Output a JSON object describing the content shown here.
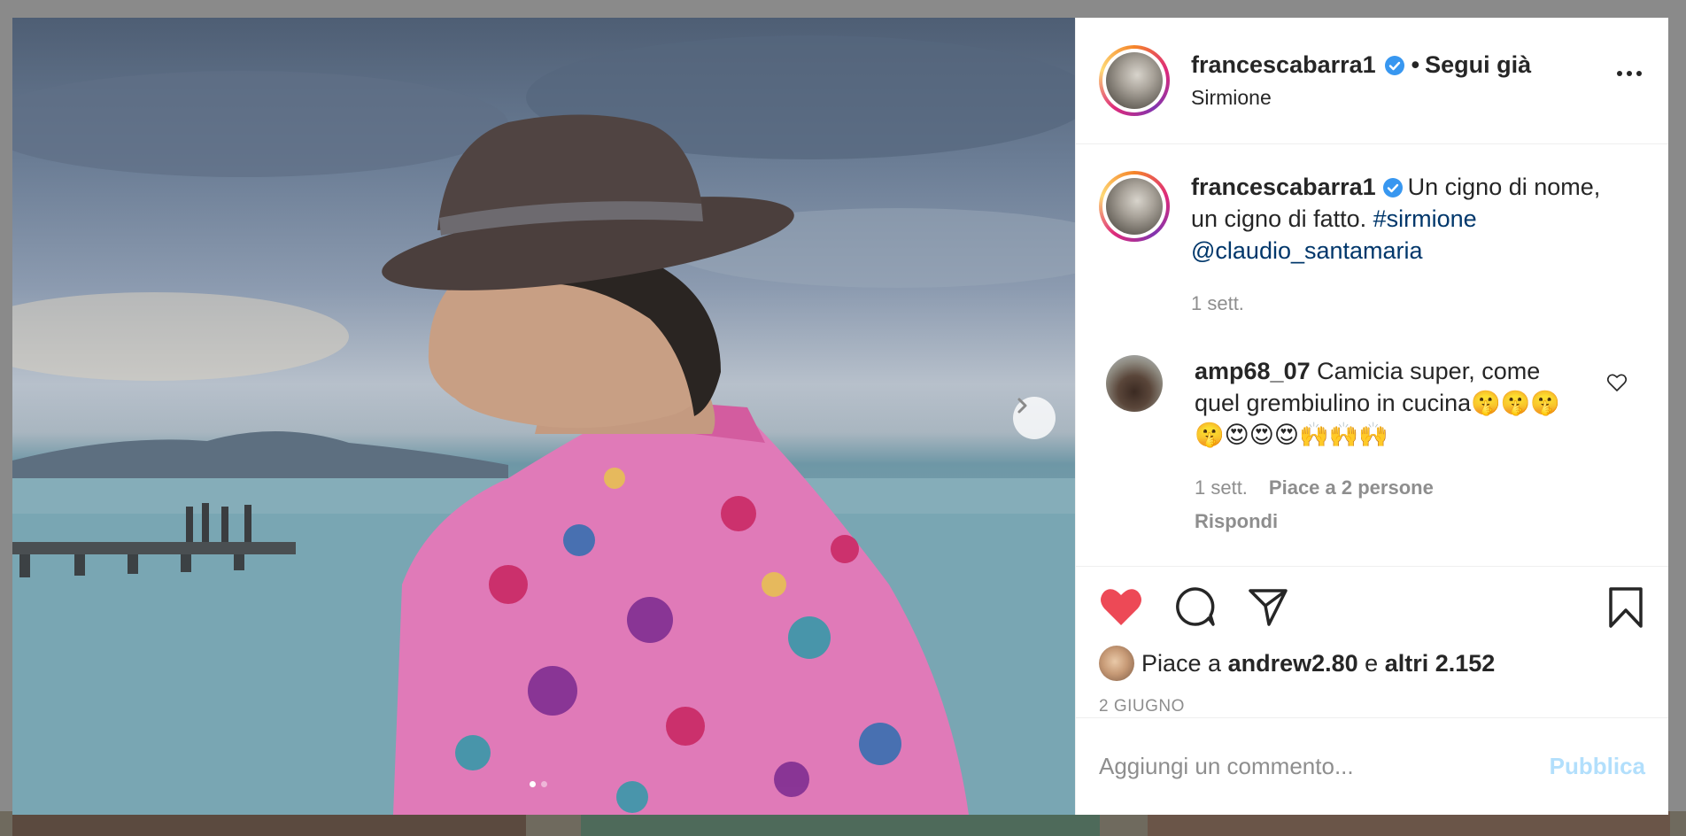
{
  "post": {
    "username": "francescabarra1",
    "separator": "•",
    "follow_label": "Segui già",
    "location": "Sirmione"
  },
  "caption": {
    "username": "francescabarra1",
    "text": "Un cigno di nome, un cigno di fatto.",
    "hashtag": "#sirmione",
    "mention": "@claudio_santamaria",
    "time": "1 sett."
  },
  "comment": {
    "username": "amp68_07",
    "text": "Camicia super, come quel grembiulino in cucina🤫🤫🤫🤫😍😍😍🙌🙌🙌",
    "time": "1 sett.",
    "likes": "Piace a 2 persone",
    "reply": "Rispondi"
  },
  "likes": {
    "prefix": "Piace a",
    "user": "andrew2.80",
    "conj": "e",
    "others": "altri 2.152"
  },
  "date": "2 GIUGNO",
  "add_comment": {
    "placeholder": "Aggiungi un commento...",
    "publish": "Pubblica"
  },
  "colors": {
    "like_active": "#ed4956",
    "verified": "#3897f0",
    "link": "#00376b",
    "publish_disabled": "#b2dffc"
  },
  "carousel": {
    "total": 2,
    "current": 1
  }
}
